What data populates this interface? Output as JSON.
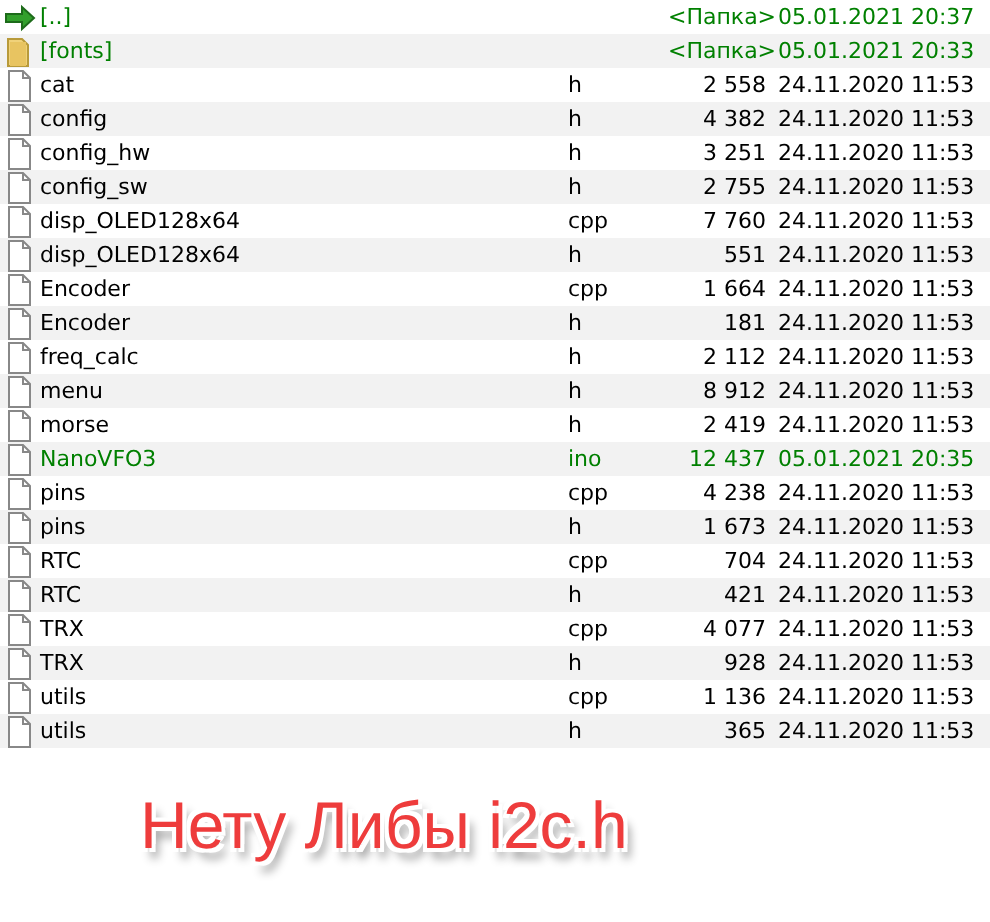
{
  "files": [
    {
      "kind": "up",
      "name": "[..]",
      "size": "<Папка>",
      "date": "05.01.2021 20:37",
      "highlighted": true
    },
    {
      "kind": "folder",
      "name": "[fonts]",
      "size": "<Папка>",
      "date": "05.01.2021 20:33",
      "highlighted": true
    },
    {
      "kind": "file",
      "name": "cat",
      "ext": "h",
      "size": "2 558",
      "date": "24.11.2020 11:53",
      "highlighted": false
    },
    {
      "kind": "file",
      "name": "config",
      "ext": "h",
      "size": "4 382",
      "date": "24.11.2020 11:53",
      "highlighted": false
    },
    {
      "kind": "file",
      "name": "config_hw",
      "ext": "h",
      "size": "3 251",
      "date": "24.11.2020 11:53",
      "highlighted": false
    },
    {
      "kind": "file",
      "name": "config_sw",
      "ext": "h",
      "size": "2 755",
      "date": "24.11.2020 11:53",
      "highlighted": false
    },
    {
      "kind": "file",
      "name": "disp_OLED128x64",
      "ext": "cpp",
      "size": "7 760",
      "date": "24.11.2020 11:53",
      "highlighted": false
    },
    {
      "kind": "file",
      "name": "disp_OLED128x64",
      "ext": "h",
      "size": "551",
      "date": "24.11.2020 11:53",
      "highlighted": false
    },
    {
      "kind": "file",
      "name": "Encoder",
      "ext": "cpp",
      "size": "1 664",
      "date": "24.11.2020 11:53",
      "highlighted": false
    },
    {
      "kind": "file",
      "name": "Encoder",
      "ext": "h",
      "size": "181",
      "date": "24.11.2020 11:53",
      "highlighted": false
    },
    {
      "kind": "file",
      "name": "freq_calc",
      "ext": "h",
      "size": "2 112",
      "date": "24.11.2020 11:53",
      "highlighted": false
    },
    {
      "kind": "file",
      "name": "menu",
      "ext": "h",
      "size": "8 912",
      "date": "24.11.2020 11:53",
      "highlighted": false
    },
    {
      "kind": "file",
      "name": "morse",
      "ext": "h",
      "size": "2 419",
      "date": "24.11.2020 11:53",
      "highlighted": false
    },
    {
      "kind": "file",
      "name": "NanoVFO3",
      "ext": "ino",
      "size": "12 437",
      "date": "05.01.2021 20:35",
      "highlighted": true
    },
    {
      "kind": "file",
      "name": "pins",
      "ext": "cpp",
      "size": "4 238",
      "date": "24.11.2020 11:53",
      "highlighted": false
    },
    {
      "kind": "file",
      "name": "pins",
      "ext": "h",
      "size": "1 673",
      "date": "24.11.2020 11:53",
      "highlighted": false
    },
    {
      "kind": "file",
      "name": "RTC",
      "ext": "cpp",
      "size": "704",
      "date": "24.11.2020 11:53",
      "highlighted": false
    },
    {
      "kind": "file",
      "name": "RTC",
      "ext": "h",
      "size": "421",
      "date": "24.11.2020 11:53",
      "highlighted": false
    },
    {
      "kind": "file",
      "name": "TRX",
      "ext": "cpp",
      "size": "4 077",
      "date": "24.11.2020 11:53",
      "highlighted": false
    },
    {
      "kind": "file",
      "name": "TRX",
      "ext": "h",
      "size": "928",
      "date": "24.11.2020 11:53",
      "highlighted": false
    },
    {
      "kind": "file",
      "name": "utils",
      "ext": "cpp",
      "size": "1 136",
      "date": "24.11.2020 11:53",
      "highlighted": false
    },
    {
      "kind": "file",
      "name": "utils",
      "ext": "h",
      "size": "365",
      "date": "24.11.2020 11:53",
      "highlighted": false
    }
  ],
  "caption": "Нету Либы i2c.h"
}
